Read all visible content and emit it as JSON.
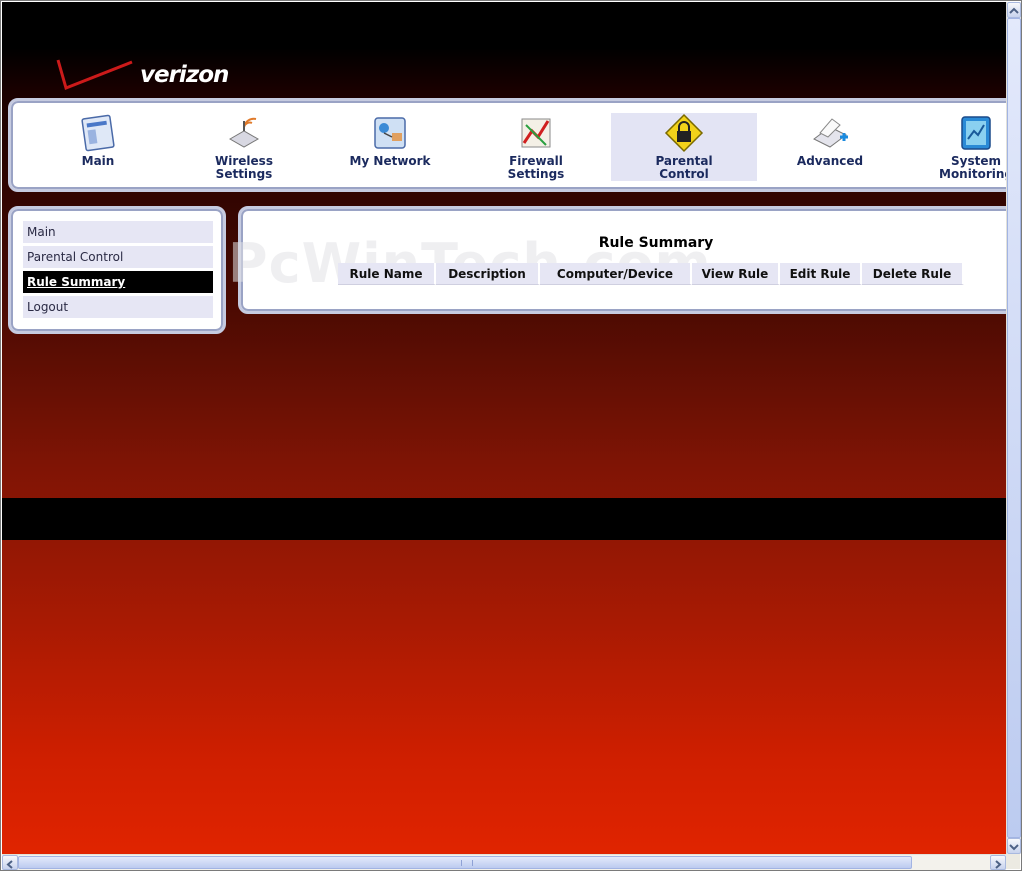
{
  "brand": {
    "logo_text": "verizon"
  },
  "nav": {
    "items": [
      {
        "label": "Main",
        "icon": "main-icon",
        "active": false
      },
      {
        "label": "Wireless\nSettings",
        "icon": "wireless-icon",
        "active": false
      },
      {
        "label": "My Network",
        "icon": "network-icon",
        "active": false
      },
      {
        "label": "Firewall\nSettings",
        "icon": "firewall-icon",
        "active": false
      },
      {
        "label": "Parental\nControl",
        "icon": "lock-icon",
        "active": true
      },
      {
        "label": "Advanced",
        "icon": "advanced-icon",
        "active": false
      },
      {
        "label": "System\nMonitoring",
        "icon": "monitor-icon",
        "active": false
      }
    ]
  },
  "sidebar": {
    "items": [
      {
        "label": "Main",
        "active": false
      },
      {
        "label": "Parental Control",
        "active": false
      },
      {
        "label": "Rule Summary",
        "active": true
      },
      {
        "label": "Logout",
        "active": false
      }
    ]
  },
  "content": {
    "title": "Rule Summary",
    "columns": [
      "Rule Name",
      "Description",
      "Computer/Device",
      "View Rule",
      "Edit Rule",
      "Delete Rule"
    ],
    "rows": []
  },
  "watermark": "PcWinTech.com",
  "colors": {
    "nav_text": "#1b2a5e",
    "active_bg": "#e3e4f4",
    "menu_bg": "#e6e6f4",
    "brand_red": "#cc0000"
  }
}
